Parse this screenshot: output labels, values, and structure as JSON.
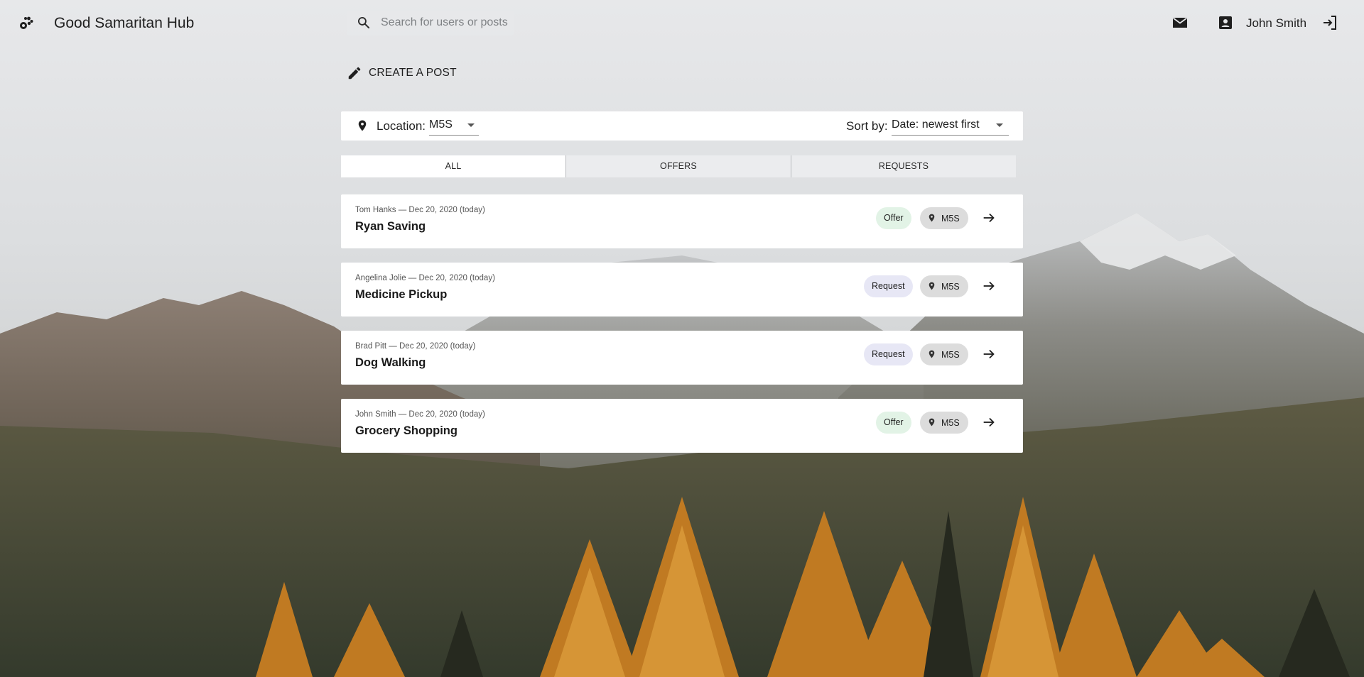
{
  "app": {
    "title": "Good Samaritan Hub"
  },
  "header": {
    "search_placeholder": "Search for users or posts",
    "user_name": "John Smith"
  },
  "actions": {
    "create_post_label": "CREATE A POST"
  },
  "filters": {
    "location_label": "Location:",
    "location_value": "M5S",
    "sort_label": "Sort by:",
    "sort_value": "Date: newest first"
  },
  "tabs": [
    {
      "label": "ALL",
      "active": true
    },
    {
      "label": "OFFERS",
      "active": false
    },
    {
      "label": "REQUESTS",
      "active": false
    }
  ],
  "posts": [
    {
      "meta": "Tom Hanks — Dec 20, 2020 (today)",
      "title": "Ryan Saving",
      "type": "Offer",
      "location": "M5S"
    },
    {
      "meta": "Angelina Jolie — Dec 20, 2020 (today)",
      "title": "Medicine Pickup",
      "type": "Request",
      "location": "M5S"
    },
    {
      "meta": "Brad Pitt — Dec 20, 2020 (today)",
      "title": "Dog Walking",
      "type": "Request",
      "location": "M5S"
    },
    {
      "meta": "John Smith — Dec 20, 2020 (today)",
      "title": "Grocery Shopping",
      "type": "Offer",
      "location": "M5S"
    }
  ],
  "colors": {
    "offer_badge": "#e2f3e6",
    "request_badge": "#e7e7f5",
    "location_badge": "#dcdcdc",
    "card_background": "#ffffff"
  },
  "icons": {
    "logo": "paw-group-icon",
    "search": "search-icon",
    "mail": "mail-icon",
    "account": "account-box-icon",
    "logout": "logout-icon",
    "create": "pencil-icon",
    "location": "map-pin-icon",
    "open_post": "arrow-right-icon"
  }
}
